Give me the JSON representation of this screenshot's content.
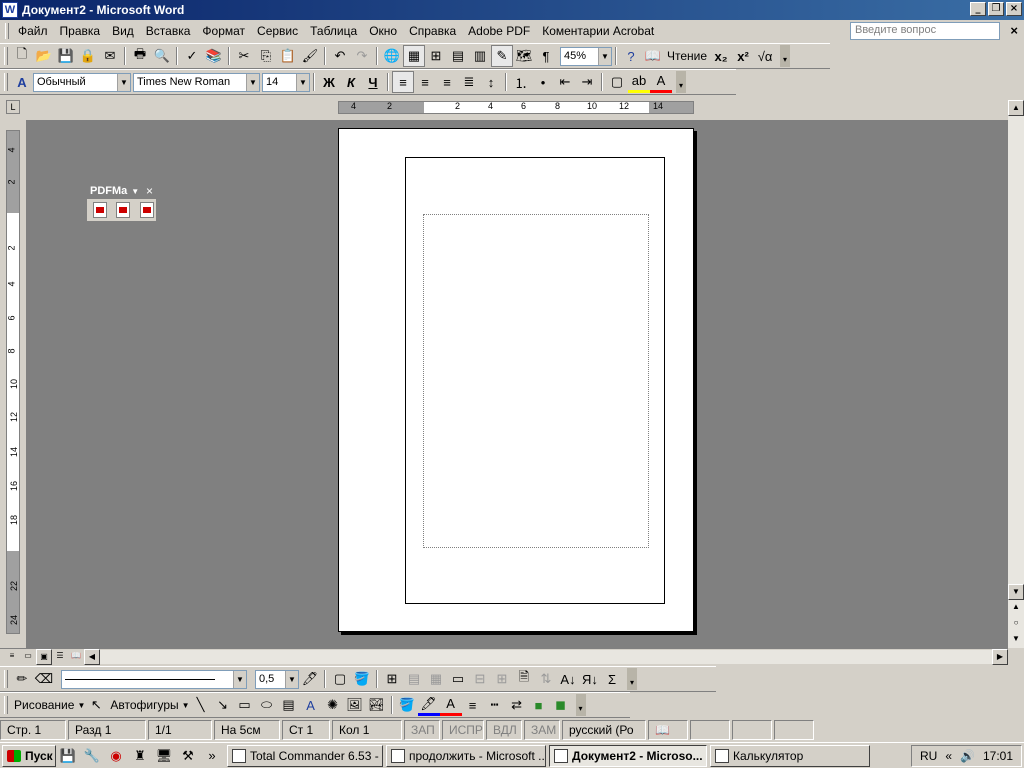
{
  "window": {
    "title": "Документ2 - Microsoft Word",
    "app_icon": "W"
  },
  "menu": {
    "items": [
      "Файл",
      "Правка",
      "Вид",
      "Вставка",
      "Формат",
      "Сервис",
      "Таблица",
      "Окно",
      "Справка",
      "Adobe PDF",
      "Коментарии Acrobat"
    ],
    "ask_placeholder": "Введите вопрос"
  },
  "standard_toolbar": {
    "zoom": "45%",
    "reading_label": "Чтение"
  },
  "formatting_toolbar": {
    "style": "Обычный",
    "font": "Times New Roman",
    "size": "14",
    "bold": "Ж",
    "italic": "К",
    "underline": "Ч"
  },
  "pdf_toolbar": {
    "title": "PDFMa"
  },
  "hruler_labels": [
    "4",
    "2",
    "2",
    "4",
    "6",
    "8",
    "10",
    "12",
    "14"
  ],
  "vruler_labels": [
    "4",
    "2",
    "2",
    "4",
    "6",
    "8",
    "10",
    "12",
    "14",
    "16",
    "18",
    "22",
    "24"
  ],
  "drawing_toolbar": {
    "draw_label": "Рисование",
    "autoshapes_label": "Автофигуры",
    "line_width": "0,5"
  },
  "status": {
    "page": "Стр. 1",
    "section": "Разд 1",
    "pages": "1/1",
    "at": "На 5см",
    "line": "Ст 1",
    "col": "Кол 1",
    "rec": "ЗАП",
    "trk": "ИСПР",
    "ext": "ВДЛ",
    "ovr": "ЗАМ",
    "lang": "русский (Ро"
  },
  "taskbar": {
    "start_label": "Пуск",
    "tasks": [
      "Total Commander 6.53 - ...",
      "продолжить - Microsoft ...",
      "Документ2 - Microso...",
      "Калькулятор"
    ],
    "lang": "RU",
    "clock": "17:01"
  }
}
